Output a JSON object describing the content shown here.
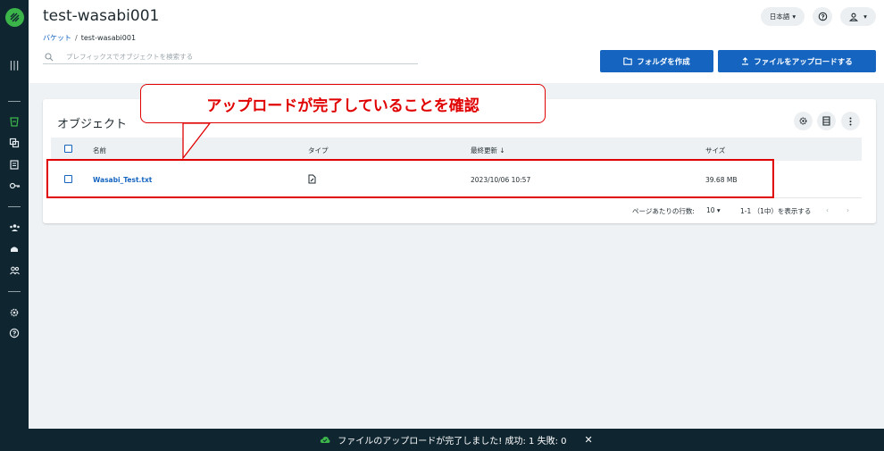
{
  "header": {
    "title": "test-wasabi001",
    "language": "日本語",
    "language_caret": "▾",
    "help_glyph": "?",
    "account_caret": "▾"
  },
  "breadcrumb": {
    "parent": "バケット",
    "separator": "/",
    "current": "test-wasabi001"
  },
  "search": {
    "placeholder": "プレフィックスでオブジェクトを検索する"
  },
  "actions": {
    "create_folder": "フォルダを作成",
    "upload_files": "ファイルをアップロードする"
  },
  "card": {
    "title": "オブジェクト",
    "columns": {
      "name": "名前",
      "type": "タイプ",
      "modified": "最終更新 ↓",
      "size": "サイズ"
    },
    "rows": [
      {
        "name": "Wasabi_Test.txt",
        "type_icon": "file-edit-icon",
        "modified": "2023/10/06 10:57",
        "size": "39.68 MB"
      }
    ],
    "pagination": {
      "rows_per_page_label": "ページあたりの行数:",
      "rows_per_page_value": "10 ▾",
      "range": "1-1 （1中）を表示する",
      "prev": "‹",
      "next": "›"
    }
  },
  "annotation": {
    "callout_text": "アップロードが完了していることを確認",
    "color": "#e00000"
  },
  "snackbar": {
    "message": "ファイルのアップロードが完了しました! 成功: 1 失敗: 0",
    "close": "✕"
  },
  "colors": {
    "sidebar": "#0f2530",
    "accent": "#1565c0",
    "brand_green": "#3bb54a"
  }
}
